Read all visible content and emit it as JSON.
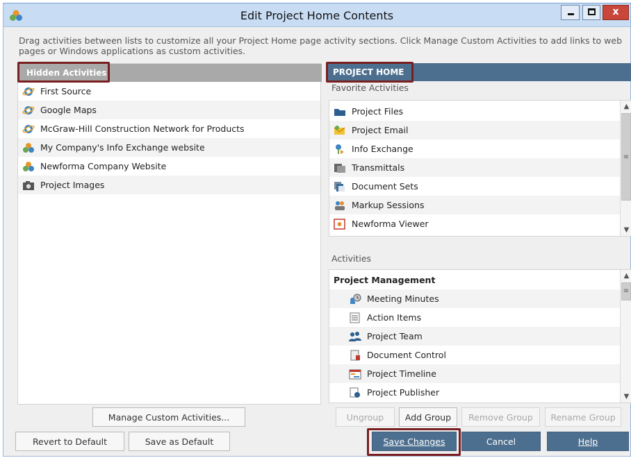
{
  "window": {
    "title": "Edit Project Home Contents",
    "controls": {
      "minimize": "_",
      "maximize": "□",
      "close": "x"
    }
  },
  "instructions": "Drag activities between lists to customize all your Project Home page activity sections.  Click Manage Custom Activities to add links to web pages or Windows applications as custom activities.",
  "hidden": {
    "header": "Hidden Activities",
    "items": [
      {
        "label": "First Source",
        "icon": "ie-icon"
      },
      {
        "label": "Google Maps",
        "icon": "ie-icon"
      },
      {
        "label": "McGraw-Hill Construction Network for Products",
        "icon": "ie-icon"
      },
      {
        "label": "My Company's Info Exchange website",
        "icon": "newforma-icon"
      },
      {
        "label": "Newforma Company Website",
        "icon": "newforma-icon"
      },
      {
        "label": "Project Images",
        "icon": "camera-icon"
      }
    ]
  },
  "project_home": {
    "header": "PROJECT HOME",
    "favorites_label": "Favorite Activities",
    "favorites": [
      {
        "label": "Project Files",
        "icon": "folder-icon"
      },
      {
        "label": "Project Email",
        "icon": "email-icon"
      },
      {
        "label": "Info Exchange",
        "icon": "info-exchange-icon"
      },
      {
        "label": "Transmittals",
        "icon": "transmittals-icon"
      },
      {
        "label": "Document Sets",
        "icon": "document-sets-icon"
      },
      {
        "label": "Markup Sessions",
        "icon": "markup-icon"
      },
      {
        "label": "Newforma Viewer",
        "icon": "viewer-icon"
      }
    ],
    "activities_label": "Activities",
    "group": "Project Management",
    "activities": [
      {
        "label": "Meeting Minutes",
        "icon": "meeting-icon"
      },
      {
        "label": "Action Items",
        "icon": "action-items-icon"
      },
      {
        "label": "Project Team",
        "icon": "team-icon"
      },
      {
        "label": "Document Control",
        "icon": "document-control-icon"
      },
      {
        "label": "Project Timeline",
        "icon": "timeline-icon"
      },
      {
        "label": "Project Publisher",
        "icon": "publisher-icon"
      }
    ]
  },
  "buttons": {
    "manage": "Manage Custom Activities...",
    "revert": "Revert to Default",
    "save_default": "Save as Default",
    "ungroup": "Ungroup",
    "add_group": "Add Group",
    "remove_group": "Remove Group",
    "rename_group": "Rename Group",
    "save_changes": "Save Changes",
    "cancel": "Cancel",
    "help": "Help"
  },
  "colors": {
    "project_home_header": "#4d6f8f",
    "hidden_header": "#a9a9a9",
    "callout": "#7a1f1f",
    "titlebar": "#c8ddf4"
  }
}
